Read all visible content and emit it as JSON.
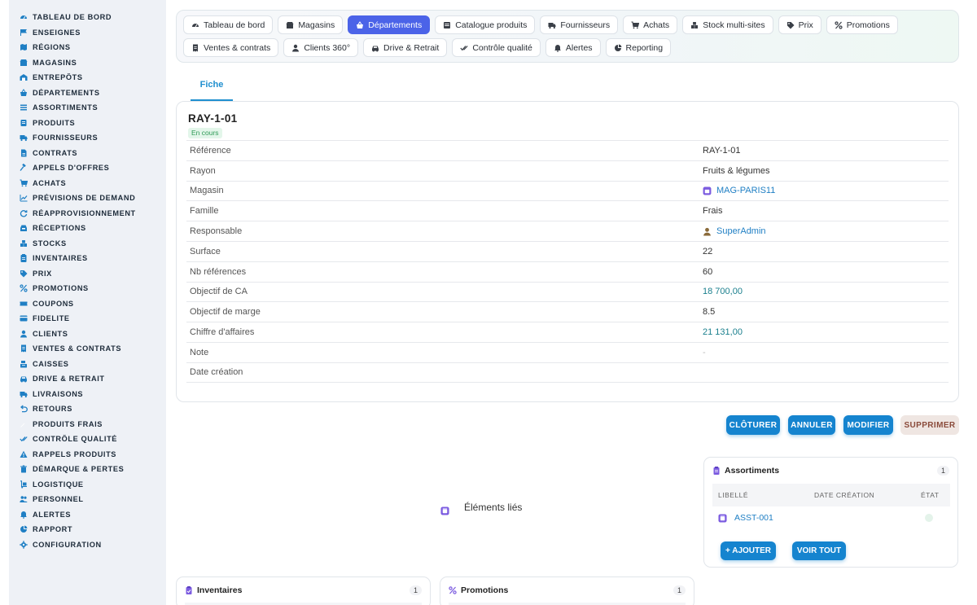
{
  "sidebar": {
    "items": [
      {
        "label": "TABLEAU DE BORD",
        "icon": "dashboard-icon"
      },
      {
        "label": "ENSEIGNES",
        "icon": "flag-icon"
      },
      {
        "label": "RÉGIONS",
        "icon": "map-icon"
      },
      {
        "label": "MAGASINS",
        "icon": "store-icon"
      },
      {
        "label": "ENTREPÔTS",
        "icon": "warehouse-icon"
      },
      {
        "label": "DÉPARTEMENTS",
        "icon": "basket-icon"
      },
      {
        "label": "ASSORTIMENTS",
        "icon": "list-icon"
      },
      {
        "label": "PRODUITS",
        "icon": "box-icon"
      },
      {
        "label": "FOURNISSEURS",
        "icon": "truck-icon"
      },
      {
        "label": "CONTRATS",
        "icon": "document-icon"
      },
      {
        "label": "APPELS D'OFFRES",
        "icon": "gavel-icon"
      },
      {
        "label": "ACHATS",
        "icon": "cart-icon"
      },
      {
        "label": "PRÉVISIONS DE DEMAND",
        "icon": "chart-icon"
      },
      {
        "label": "RÉAPPROVISIONNEMENT",
        "icon": "refresh-icon"
      },
      {
        "label": "RÉCEPTIONS",
        "icon": "inbox-icon"
      },
      {
        "label": "STOCKS",
        "icon": "boxes-icon"
      },
      {
        "label": "INVENTAIRES",
        "icon": "clipboard-icon"
      },
      {
        "label": "PRIX",
        "icon": "tag-icon"
      },
      {
        "label": "PROMOTIONS",
        "icon": "percent-icon"
      },
      {
        "label": "COUPONS",
        "icon": "ticket-icon"
      },
      {
        "label": "FIDELITE",
        "icon": "card-icon"
      },
      {
        "label": "CLIENTS",
        "icon": "user-icon"
      },
      {
        "label": "VENTES & CONTRATS",
        "icon": "receipt-icon"
      },
      {
        "label": "CAISSES",
        "icon": "cash-register-icon"
      },
      {
        "label": "DRIVE & RETRAIT",
        "icon": "car-icon"
      },
      {
        "label": "LIVRAISONS",
        "icon": "delivery-icon"
      },
      {
        "label": "RETOURS",
        "icon": "undo-icon"
      },
      {
        "label": "PRODUITS FRAIS",
        "icon": "leaf-icon"
      },
      {
        "label": "CONTRÔLE QUALITÉ",
        "icon": "check-double-icon"
      },
      {
        "label": "RAPPELS PRODUITS",
        "icon": "warning-icon"
      },
      {
        "label": "DÉMARQUE & PERTES",
        "icon": "trash-icon"
      },
      {
        "label": "LOGISTIQUE",
        "icon": "dolly-icon"
      },
      {
        "label": "PERSONNEL",
        "icon": "users-icon"
      },
      {
        "label": "ALERTES",
        "icon": "bell-icon"
      },
      {
        "label": "RAPPORT",
        "icon": "pie-chart-icon"
      },
      {
        "label": "CONFIGURATION",
        "icon": "gear-icon"
      }
    ]
  },
  "tabs": {
    "row1": [
      {
        "label": "Tableau de bord",
        "icon": "dashboard-icon",
        "active": false
      },
      {
        "label": "Magasins",
        "icon": "store-icon",
        "active": false
      },
      {
        "label": "Départements",
        "icon": "basket-icon",
        "active": true
      },
      {
        "label": "Catalogue produits",
        "icon": "grid-icon",
        "active": false
      },
      {
        "label": "Fournisseurs",
        "icon": "truck-icon",
        "active": false
      },
      {
        "label": "Achats",
        "icon": "cart-icon",
        "active": false
      },
      {
        "label": "Stock multi-sites",
        "icon": "boxes-icon",
        "active": false
      },
      {
        "label": "Prix",
        "icon": "tags-icon",
        "active": false
      },
      {
        "label": "Promotions",
        "icon": "percent-icon",
        "active": false
      }
    ],
    "row2": [
      {
        "label": "Ventes & contrats",
        "icon": "receipt-icon",
        "active": false
      },
      {
        "label": "Clients 360°",
        "icon": "user-icon",
        "active": false
      },
      {
        "label": "Drive & Retrait",
        "icon": "car-icon",
        "active": false
      },
      {
        "label": "Contrôle qualité",
        "icon": "check-double-icon",
        "active": false
      },
      {
        "label": "Alertes",
        "icon": "bell-icon",
        "active": false
      },
      {
        "label": "Reporting",
        "icon": "pie-chart-icon",
        "active": false
      }
    ]
  },
  "fiche_tab": "Fiche",
  "record": {
    "title": "RAY-1-01",
    "status": "En cours",
    "fields": [
      {
        "key": "Référence",
        "value": "RAY-1-01",
        "style": "plain"
      },
      {
        "key": "Rayon",
        "value": "Fruits & légumes",
        "style": "plain"
      },
      {
        "key": "Magasin",
        "value": "MAG-PARIS11",
        "style": "link",
        "icon": "store-badge-icon"
      },
      {
        "key": "Famille",
        "value": "Frais",
        "style": "plain"
      },
      {
        "key": "Responsable",
        "value": "SuperAdmin",
        "style": "link",
        "icon": "user-icon"
      },
      {
        "key": "Surface",
        "value": "22",
        "style": "plain"
      },
      {
        "key": "Nb références",
        "value": "60",
        "style": "plain"
      },
      {
        "key": "Objectif de CA",
        "value": "18 700,00",
        "style": "num"
      },
      {
        "key": "Objectif de marge",
        "value": "8.5",
        "style": "plain"
      },
      {
        "key": "Chiffre d'affaires",
        "value": "21 131,00",
        "style": "num"
      },
      {
        "key": "Note",
        "value": "-",
        "style": "muted"
      },
      {
        "key": "Date création",
        "value": "",
        "style": "plain"
      }
    ]
  },
  "actions": {
    "cloturer": "CLÔTURER",
    "annuler": "ANNULER",
    "modifier": "MODIFIER",
    "supprimer": "SUPPRIMER"
  },
  "linked": {
    "label": "Éléments liés"
  },
  "assortiments": {
    "title": "Assortiments",
    "count": "1",
    "columns": [
      "LIBELLÉ",
      "DATE CRÉATION",
      "ÉTAT"
    ],
    "rows": [
      {
        "libelle": "ASST-001"
      }
    ],
    "add_label": "+ AJOUTER",
    "all_label": "VOIR TOUT"
  },
  "inventaires": {
    "title": "Inventaires",
    "count": "1"
  },
  "promotions": {
    "title": "Promotions",
    "count": "1"
  },
  "colors": {
    "accent": "#4b63e8",
    "primary_button": "#1584cf",
    "link": "#1f7fc4",
    "status_green": "#2f9a57"
  }
}
